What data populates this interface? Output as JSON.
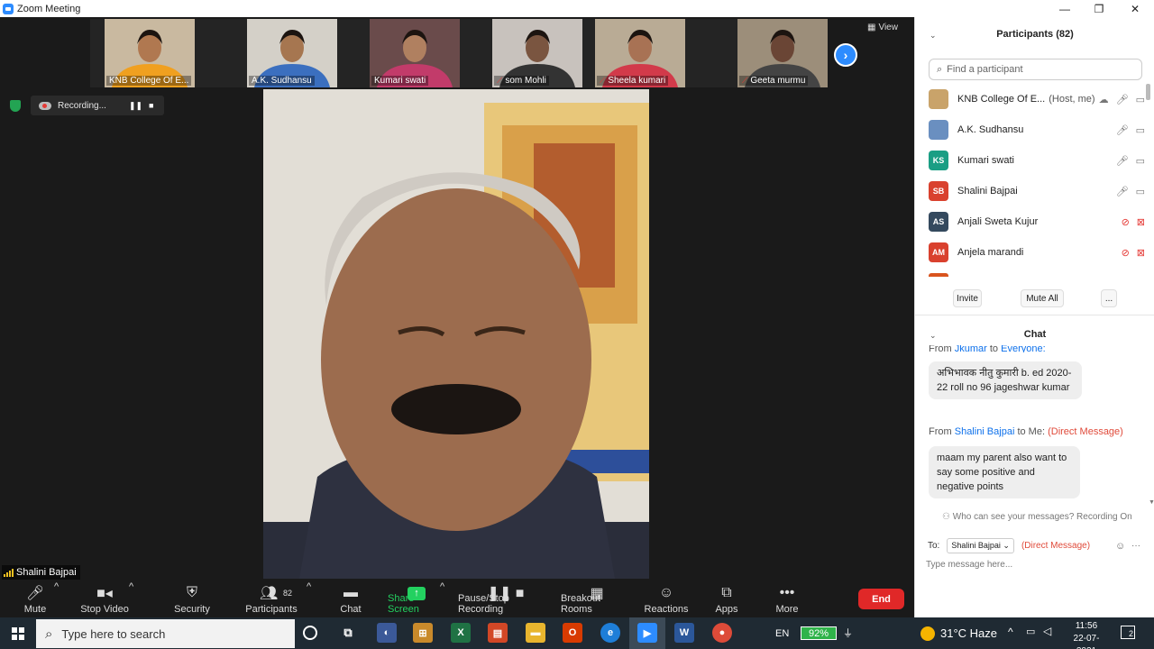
{
  "window": {
    "title": "Zoom Meeting",
    "controls": [
      "—",
      "❐",
      "✕"
    ]
  },
  "thumbnails": [
    {
      "name": "KNB College Of E...",
      "muted": false,
      "bg": "#c9b9a0",
      "skin": "#b07850",
      "shirt": "#f0a020"
    },
    {
      "name": "A.K. Sudhansu",
      "muted": false,
      "bg": "#d4d0c8",
      "skin": "#a67650",
      "shirt": "#3b6fbf"
    },
    {
      "name": "Kumari swati",
      "muted": false,
      "bg": "#6a4b4b",
      "skin": "#b08060",
      "shirt": "#c23b6a"
    },
    {
      "name": "som Mohli",
      "muted": true,
      "bg": "#c8c2bd",
      "skin": "#7a5540",
      "shirt": "#333333"
    },
    {
      "name": "Sheela kumari",
      "muted": true,
      "bg": "#b9ab95",
      "skin": "#a87254",
      "shirt": "#d23a4a"
    },
    {
      "name": "Geeta murmu",
      "muted": true,
      "bg": "#9c8e7a",
      "skin": "#6a4535",
      "shirt": "#444444"
    }
  ],
  "view_label": "View",
  "recording": {
    "label": "Recording...",
    "pause": "❚❚",
    "stop": "■"
  },
  "active_speaker": "Shalini Bajpai",
  "toolbar": {
    "mute": "Mute",
    "stop_video": "Stop Video",
    "security": "Security",
    "participants": "Participants",
    "participants_count": "82",
    "chat": "Chat",
    "share_screen": "Share Screen",
    "pause_stop_recording": "Pause/Stop Recording",
    "breakout_rooms": "Breakout Rooms",
    "reactions": "Reactions",
    "apps": "Apps",
    "more": "More",
    "end": "End"
  },
  "participants_panel": {
    "title": "Participants (82)",
    "search_placeholder": "Find a participant",
    "list": [
      {
        "initials": "",
        "name": "KNB College Of E...",
        "tag": "(Host, me)",
        "color": "#c9a36a",
        "muted": false,
        "cam_off": false,
        "photo": true
      },
      {
        "initials": "",
        "name": "A.K. Sudhansu",
        "tag": "",
        "color": "#6a8fc0",
        "muted": false,
        "cam_off": false,
        "photo": true
      },
      {
        "initials": "KS",
        "name": "Kumari swati",
        "tag": "",
        "color": "#1a9e84",
        "muted": false,
        "cam_off": false,
        "photo": false
      },
      {
        "initials": "SB",
        "name": "Shalini Bajpai",
        "tag": "",
        "color": "#d9412e",
        "muted": false,
        "cam_off": false,
        "photo": false
      },
      {
        "initials": "AS",
        "name": "Anjali Sweta Kujur",
        "tag": "",
        "color": "#34495e",
        "muted": true,
        "cam_off": true,
        "photo": false
      },
      {
        "initials": "AM",
        "name": "Anjela marandi",
        "tag": "",
        "color": "#d9412e",
        "muted": true,
        "cam_off": true,
        "photo": false
      }
    ],
    "invite": "Invite",
    "mute_all": "Mute All",
    "more": "..."
  },
  "chat": {
    "title": "Chat",
    "partial_head": {
      "prefix": "From",
      "sender": "Jkumar",
      "to": "to",
      "recipient": "Everyone:"
    },
    "messages": [
      {
        "text": "अभिभावक नीतु कुमारी b. ed 2020-22 roll no 96  jageshwar kumar"
      },
      {
        "from_label": "From",
        "sender": "Shalini Bajpai",
        "to_label": "to Me:",
        "dm": "(Direct Message)",
        "text": "maam my parent also want to say some positive and negative points"
      }
    ],
    "privacy_note": "Who can see your messages? Recording On",
    "to_label": "To:",
    "to_value": "Shalini Bajpai",
    "to_dm": "(Direct Message)",
    "input_placeholder": "Type message here..."
  },
  "taskbar": {
    "search_placeholder": "Type here to search",
    "lang": "EN",
    "battery": "92%",
    "weather": "31°C  Haze",
    "time": "11:56",
    "date": "22-07-2021",
    "notifications": "2"
  }
}
